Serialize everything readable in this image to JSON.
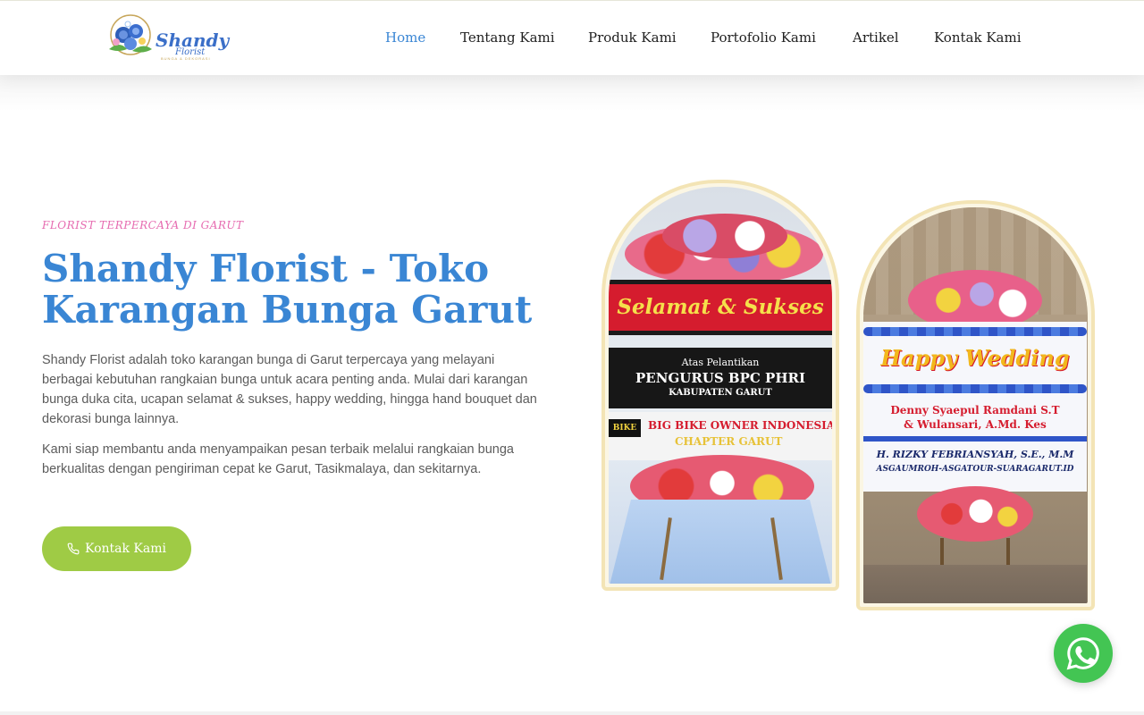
{
  "header": {
    "logo": {
      "text": "Shandy",
      "sub": "Florist",
      "tag": "BUNGA & DEKORASI"
    },
    "nav": [
      {
        "label": "Home",
        "active": true
      },
      {
        "label": "Tentang Kami",
        "active": false
      },
      {
        "label": "Produk Kami",
        "active": false
      },
      {
        "label": "Portofolio Kami",
        "active": false
      },
      {
        "label": "Artikel",
        "active": false
      },
      {
        "label": "Kontak Kami",
        "active": false
      }
    ]
  },
  "hero": {
    "tagline": "FLORIST TERPERCAYA DI GARUT",
    "title": "Shandy Florist - Toko Karangan Bunga Garut",
    "paragraph1": "Shandy Florist adalah toko karangan bunga di Garut terpercaya yang melayani berbagai kebutuhan rangkaian bunga untuk acara penting anda. Mulai dari karangan bunga duka cita, ucapan selamat & sukses, happy wedding, hingga hand bouquet dan dekorasi bunga lainnya.",
    "paragraph2": "Kami siap membantu anda menyampaikan pesan terbaik melalui rangkaian bunga berkualitas dengan pengiriman cepat ke Garut, Tasikmalaya, dan sekitarnya.",
    "cta_label": "Kontak Kami"
  },
  "images": {
    "left": {
      "line1": "Selamat & Sukses",
      "line2": "Atas Pelantikan",
      "line3": "PENGURUS BPC PHRI",
      "line4": "KABUPATEN GARUT",
      "line5": "BIG BIKE OWNER INDONESIA",
      "line6": "CHAPTER GARUT",
      "badge": "BIKE"
    },
    "right": {
      "line1": "Happy Wedding",
      "line2": "Denny Syaepul Ramdani S.T",
      "line3": "& Wulansari, A.Md. Kes",
      "line4": "H. RIZKY FEBRIANSYAH, S.E., M.M",
      "line5": "ASGAUMROH-ASGATOUR-SUARAGARUT.ID"
    }
  },
  "colors": {
    "accent": "#3a86d4",
    "tagline": "#e66bb0",
    "cta": "#9fcb45",
    "whatsapp": "#43c553",
    "frame": "#f3e4b5"
  },
  "icons": {
    "cta": "phone-icon",
    "float": "whatsapp-icon"
  }
}
